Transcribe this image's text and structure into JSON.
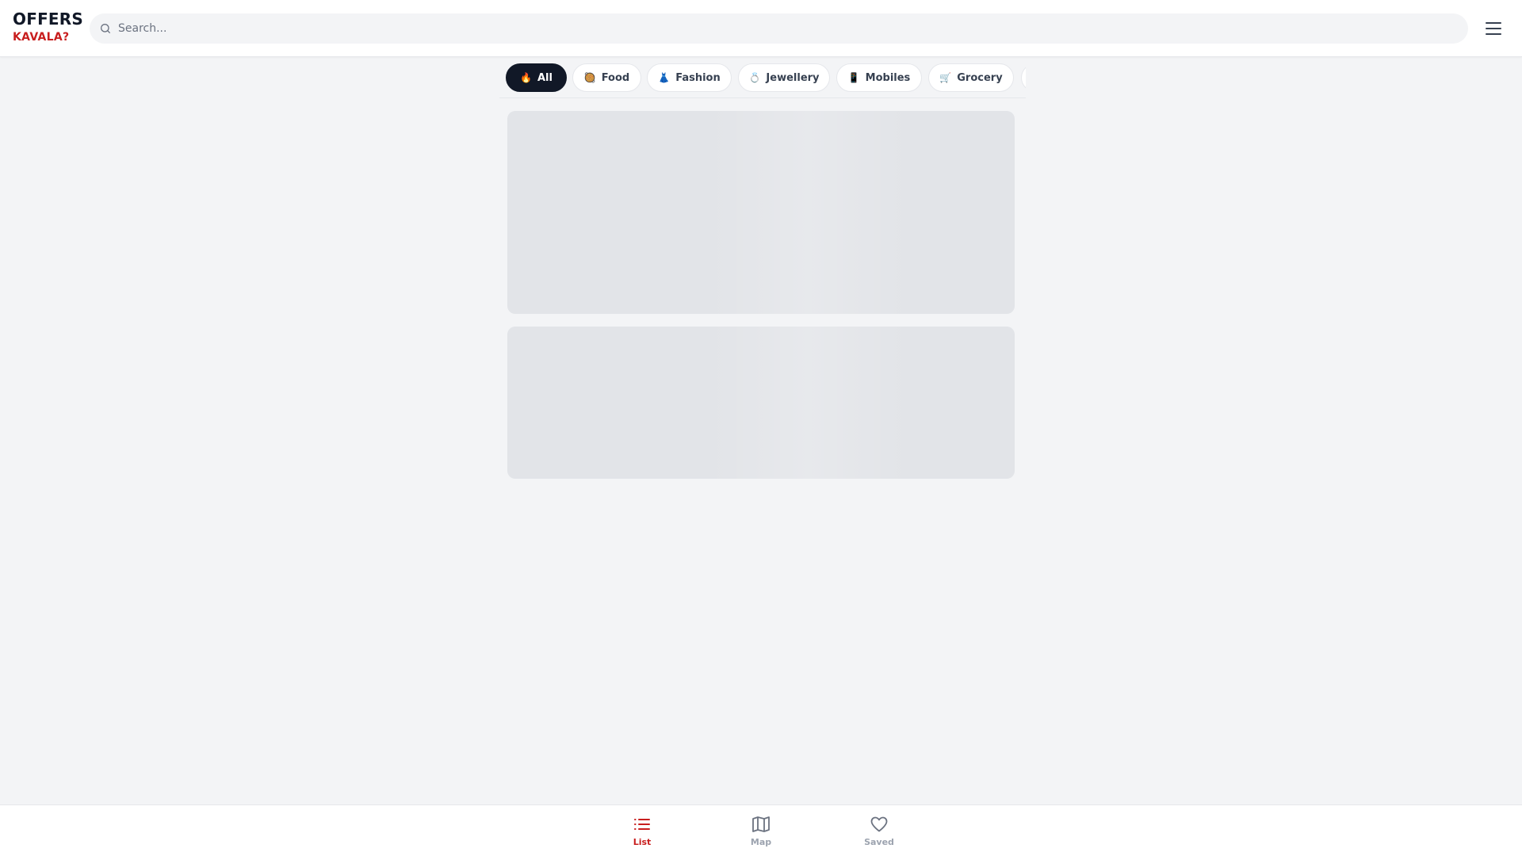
{
  "header": {
    "logo_title": "OFFERS",
    "logo_subtitle": "KAVALA?",
    "search_placeholder": "Search...",
    "menu_icon": "hamburger-menu-icon"
  },
  "categories": [
    {
      "emoji": "🔥",
      "label": "All",
      "active": true
    },
    {
      "emoji": "🥘",
      "label": "Food",
      "active": false
    },
    {
      "emoji": "👗",
      "label": "Fashion",
      "active": false
    },
    {
      "emoji": "💍",
      "label": "Jewellery",
      "active": false
    },
    {
      "emoji": "📱",
      "label": "Mobiles",
      "active": false
    },
    {
      "emoji": "🛒",
      "label": "Grocery",
      "active": false
    }
  ],
  "bottom_nav": [
    {
      "label": "List",
      "icon": "list-icon",
      "active": true
    },
    {
      "label": "Map",
      "icon": "map-icon",
      "active": false
    },
    {
      "label": "Saved",
      "icon": "heart-icon",
      "active": false
    }
  ],
  "colors": {
    "brand_red": "#c81e1e",
    "active_pill": "#111827",
    "background": "#f3f4f6",
    "skeleton": "#e2e4e8"
  }
}
